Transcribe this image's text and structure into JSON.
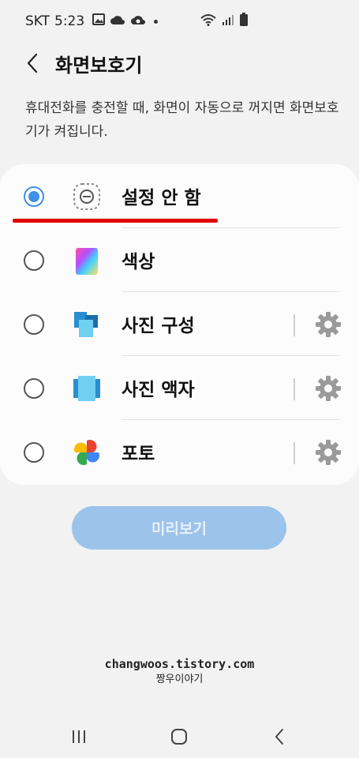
{
  "status_bar": {
    "carrier": "SKT",
    "time": "5:23",
    "icons": [
      "gallery-icon",
      "cloud-icon",
      "cloud-sync-icon",
      "dot-icon"
    ],
    "right_icons": [
      "wifi-icon",
      "signal-icon",
      "battery-icon"
    ]
  },
  "header": {
    "title": "화면보호기"
  },
  "description": "휴대전화를 충전할 때, 화면이 자동으로 꺼지면 화면보호기가 켜집니다.",
  "options": [
    {
      "label": "설정 안 함",
      "selected": true,
      "icon": "none-icon",
      "has_settings": false
    },
    {
      "label": "색상",
      "selected": false,
      "icon": "colors-icon",
      "has_settings": false
    },
    {
      "label": "사진 구성",
      "selected": false,
      "icon": "photo-table-icon",
      "has_settings": true
    },
    {
      "label": "사진 액자",
      "selected": false,
      "icon": "photo-frame-icon",
      "has_settings": true
    },
    {
      "label": "포토",
      "selected": false,
      "icon": "google-photos-icon",
      "has_settings": true
    }
  ],
  "preview_button": "미리보기",
  "watermark": {
    "line1": "changwoos.tistory.com",
    "line2": "짱우이야기"
  },
  "colors": {
    "accent": "#3e91e6",
    "preview_button_bg": "#9cc3ea",
    "underline": "#e30000"
  }
}
